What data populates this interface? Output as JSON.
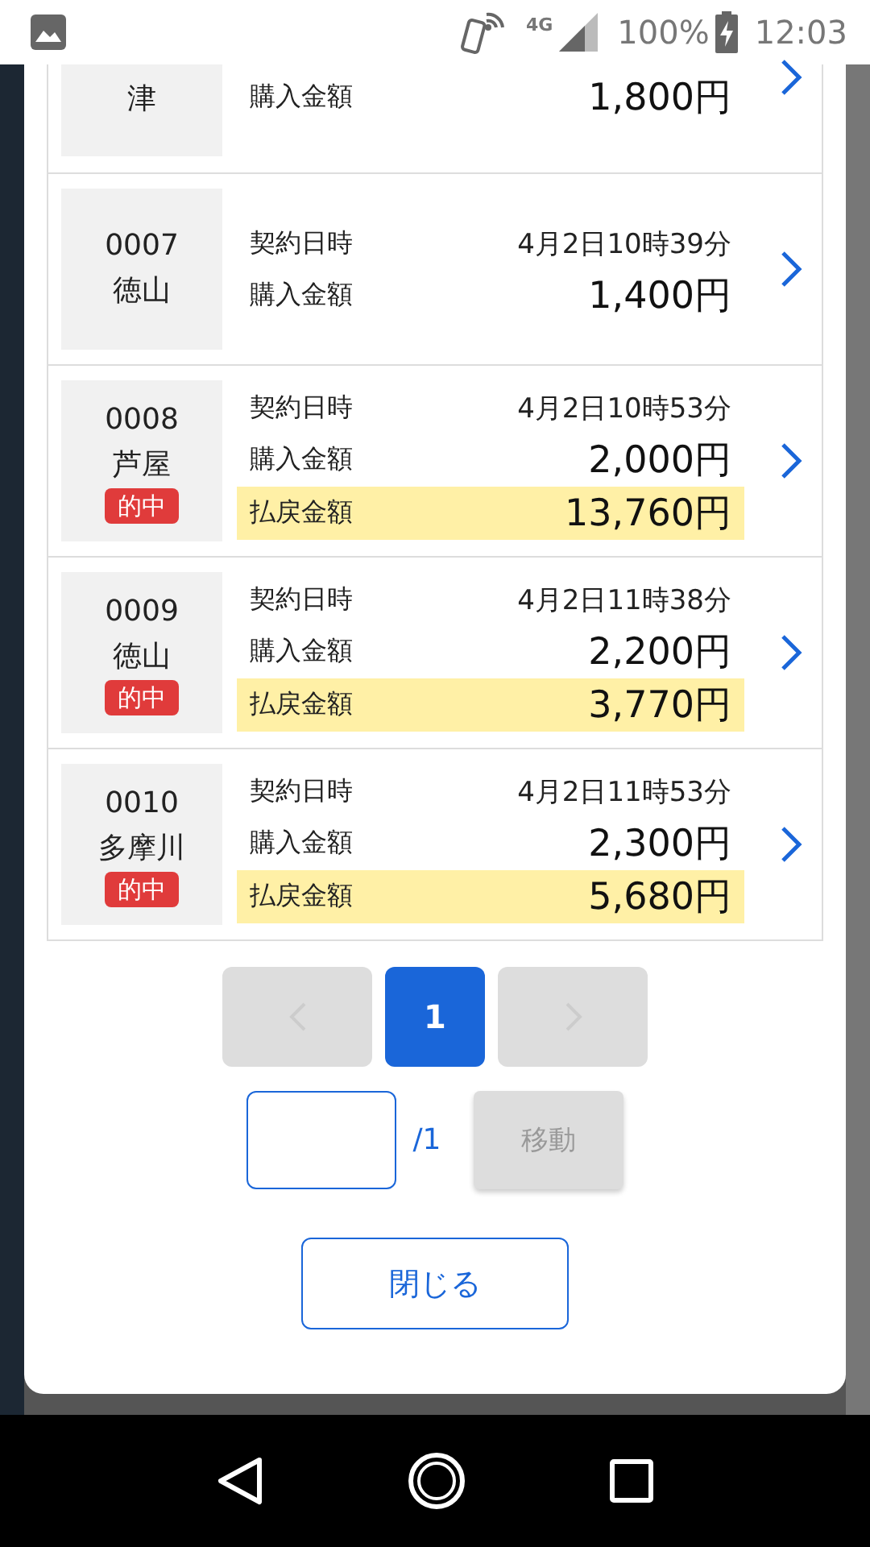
{
  "status_bar": {
    "network": "4G",
    "battery": "100%",
    "time": "12:03"
  },
  "rows": [
    {
      "venue": "津",
      "purchase_label": "購入金額",
      "purchase": "1,800円"
    },
    {
      "number": "0007",
      "venue": "徳山",
      "date_label": "契約日時",
      "date": "4月2日10時39分",
      "purchase_label": "購入金額",
      "purchase": "1,400円"
    },
    {
      "number": "0008",
      "venue": "芦屋",
      "badge": "的中",
      "date_label": "契約日時",
      "date": "4月2日10時53分",
      "purchase_label": "購入金額",
      "purchase": "2,000円",
      "payout_label": "払戻金額",
      "payout": "13,760円"
    },
    {
      "number": "0009",
      "venue": "徳山",
      "badge": "的中",
      "date_label": "契約日時",
      "date": "4月2日11時38分",
      "purchase_label": "購入金額",
      "purchase": "2,200円",
      "payout_label": "払戻金額",
      "payout": "3,770円"
    },
    {
      "number": "0010",
      "venue": "多摩川",
      "badge": "的中",
      "date_label": "契約日時",
      "date": "4月2日11時53分",
      "purchase_label": "購入金額",
      "purchase": "2,300円",
      "payout_label": "払戻金額",
      "payout": "5,680円"
    }
  ],
  "pagination": {
    "prev_disabled": true,
    "pages": [
      {
        "label": "1",
        "selected": true
      }
    ],
    "next_disabled": true
  },
  "page_jump": {
    "total": "/1",
    "button": "移動",
    "button_disabled": true
  },
  "close_button": "閉じる"
}
